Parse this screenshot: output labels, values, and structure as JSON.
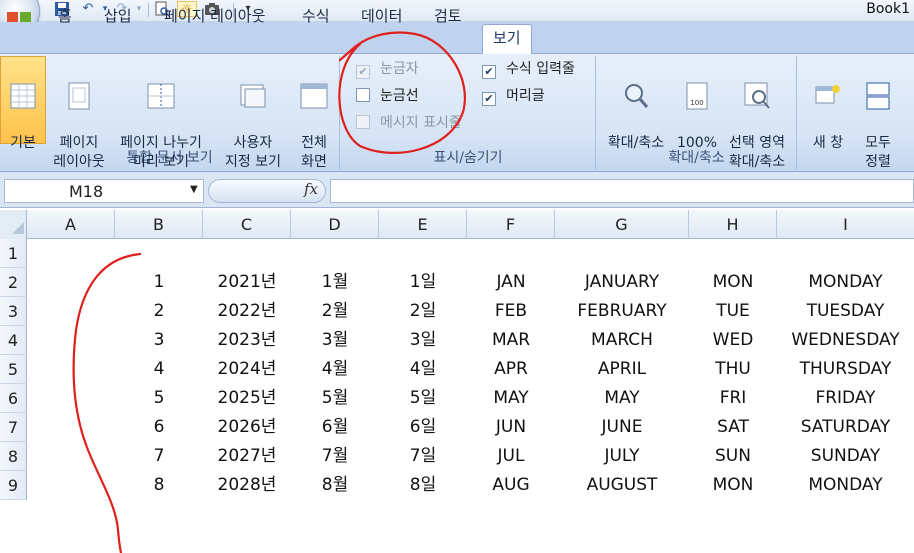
{
  "window": {
    "book_title": "Book1"
  },
  "tabs": [
    {
      "label": "홈"
    },
    {
      "label": "삽입"
    },
    {
      "label": "페이지 레이아웃"
    },
    {
      "label": "수식"
    },
    {
      "label": "데이터"
    },
    {
      "label": "검토"
    },
    {
      "label": "보기",
      "active": true
    }
  ],
  "ribbon": {
    "workbook_views": {
      "label": "통합 문서 보기",
      "buttons": [
        {
          "label": "기본"
        },
        {
          "label": "페이지\n레이아웃"
        },
        {
          "label": "페이지 나누기\n미리 보기"
        },
        {
          "label": "사용자\n지정 보기"
        },
        {
          "label": "전체\n화면"
        }
      ]
    },
    "show_hide": {
      "label": "표시/숨기기",
      "items": [
        {
          "label": "눈금자",
          "checked": true,
          "disabled": true
        },
        {
          "label": "눈금선",
          "checked": false,
          "disabled": false
        },
        {
          "label": "메시지 표시줄",
          "checked": false,
          "disabled": true
        },
        {
          "label": "수식 입력줄",
          "checked": true,
          "disabled": false
        },
        {
          "label": "머리글",
          "checked": true,
          "disabled": false
        }
      ]
    },
    "zoom": {
      "label": "확대/축소",
      "buttons": [
        {
          "label": "확대/축소"
        },
        {
          "label": "100%"
        },
        {
          "label": "선택 영역\n확대/축소"
        }
      ]
    },
    "window": {
      "buttons": [
        {
          "label": "새 창"
        },
        {
          "label": "모두\n정렬"
        }
      ]
    }
  },
  "formula_bar": {
    "name_box": "M18",
    "fx": "fx",
    "value": ""
  },
  "grid": {
    "columns": [
      "A",
      "B",
      "C",
      "D",
      "E",
      "F",
      "G",
      "H",
      "I"
    ],
    "rows": [
      "1",
      "2",
      "3",
      "4",
      "5",
      "6",
      "7",
      "8",
      "9"
    ],
    "data": [
      [
        "1",
        "2021년",
        "1월",
        "1일",
        "JAN",
        "JANUARY",
        "MON",
        "MONDAY"
      ],
      [
        "2",
        "2022년",
        "2월",
        "2일",
        "FEB",
        "FEBRUARY",
        "TUE",
        "TUESDAY"
      ],
      [
        "3",
        "2023년",
        "3월",
        "3일",
        "MAR",
        "MARCH",
        "WED",
        "WEDNESDAY"
      ],
      [
        "4",
        "2024년",
        "4월",
        "4일",
        "APR",
        "APRIL",
        "THU",
        "THURSDAY"
      ],
      [
        "5",
        "2025년",
        "5월",
        "5일",
        "MAY",
        "MAY",
        "FRI",
        "FRIDAY"
      ],
      [
        "6",
        "2026년",
        "6월",
        "6일",
        "JUN",
        "JUNE",
        "SAT",
        "SATURDAY"
      ],
      [
        "7",
        "2027년",
        "7월",
        "7일",
        "JUL",
        "JULY",
        "SUN",
        "SUNDAY"
      ],
      [
        "8",
        "2028년",
        "8월",
        "8일",
        "AUG",
        "AUGUST",
        "MON",
        "MONDAY"
      ]
    ]
  },
  "annotations": {
    "ink_color": "#e0201e"
  }
}
